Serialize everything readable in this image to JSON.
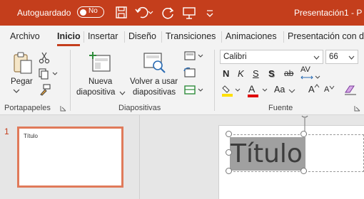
{
  "titlebar": {
    "autosave_label": "Autoguardado",
    "toggle_state": "No",
    "doc_title": "Presentación1  -  P"
  },
  "tabs": [
    "Archivo",
    "Inicio",
    "Insertar",
    "Diseño",
    "Transiciones",
    "Animaciones",
    "Presentación con d"
  ],
  "ribbon": {
    "clipboard": {
      "paste_label": "Pegar",
      "group_label": "Portapapeles"
    },
    "slides": {
      "new_slide_line1": "Nueva",
      "new_slide_line2": "diapositiva",
      "reuse_line1": "Volver a usar",
      "reuse_line2": "diapositivas",
      "group_label": "Diapositivas"
    },
    "font": {
      "font_name": "Calibri",
      "font_size": "66",
      "group_label": "Fuente",
      "bold": "N",
      "italic": "K",
      "underline": "S",
      "shadow": "S",
      "strike": "ab",
      "spacing": "AV",
      "case": "Aa",
      "grow": "A",
      "shrink": "A",
      "color_letter": "A"
    }
  },
  "slide_panel": {
    "slide_number": "1",
    "thumb_title": "Título"
  },
  "slide": {
    "title_text": "Título"
  },
  "colors": {
    "accent": "#c43e1c",
    "thumb_border": "#e07a5a",
    "highlight_yellow": "#ffe000",
    "font_color_red": "#e00000"
  }
}
